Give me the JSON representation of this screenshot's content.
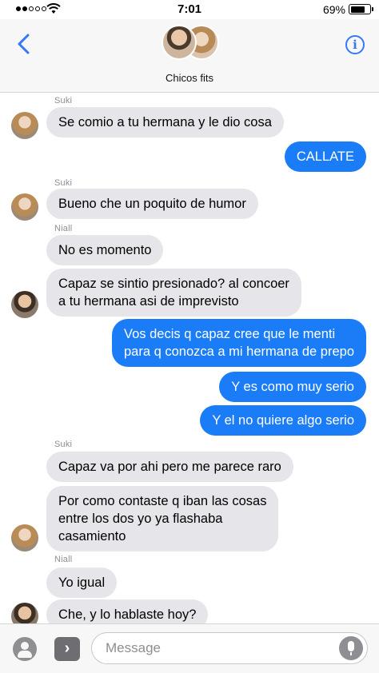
{
  "status_bar": {
    "time": "7:01",
    "battery": "69%",
    "battery_level": 0.69
  },
  "header": {
    "title": "Chicos fits",
    "info_label": "i"
  },
  "messages": [
    {
      "sender": "Suki",
      "text": "Se comio a tu hermana y le dio cosa",
      "direction": "incoming"
    },
    {
      "text": "CALLATE",
      "direction": "outgoing"
    },
    {
      "sender": "Suki",
      "text": "Bueno che un poquito de humor",
      "direction": "incoming"
    },
    {
      "sender": "Niall",
      "text": "No es momento",
      "direction": "incoming"
    },
    {
      "text": "Capaz se sintio presionado? al concoer\na tu hermana asi de imprevisto",
      "direction": "incoming"
    },
    {
      "text": "Vos decis q capaz cree que le menti\npara q conozca a mi hermana de prepo",
      "direction": "outgoing"
    },
    {
      "text": "Y es como muy serio",
      "direction": "outgoing"
    },
    {
      "text": "Y el no quiere algo serio",
      "direction": "outgoing"
    },
    {
      "sender": "Suki",
      "text": "Capaz va por ahi pero me parece raro",
      "direction": "incoming"
    },
    {
      "text": "Por como contaste q iban las cosas\nentre los dos yo ya flashaba\ncasamiento",
      "direction": "incoming"
    },
    {
      "sender": "Niall",
      "text": "Yo igual",
      "direction": "incoming"
    },
    {
      "text": "Che, y lo hablaste hoy?",
      "direction": "incoming"
    }
  ],
  "input": {
    "placeholder": "Message"
  },
  "icons": {
    "back": "chevron-left-icon",
    "info": "info-icon",
    "camera": "camera-icon",
    "apps": "app-store-icon",
    "mic": "microphone-icon"
  },
  "colors": {
    "accent": "#3478f6",
    "outgoing_bubble": "#1a7cf6",
    "incoming_bubble": "#e5e5ea"
  }
}
